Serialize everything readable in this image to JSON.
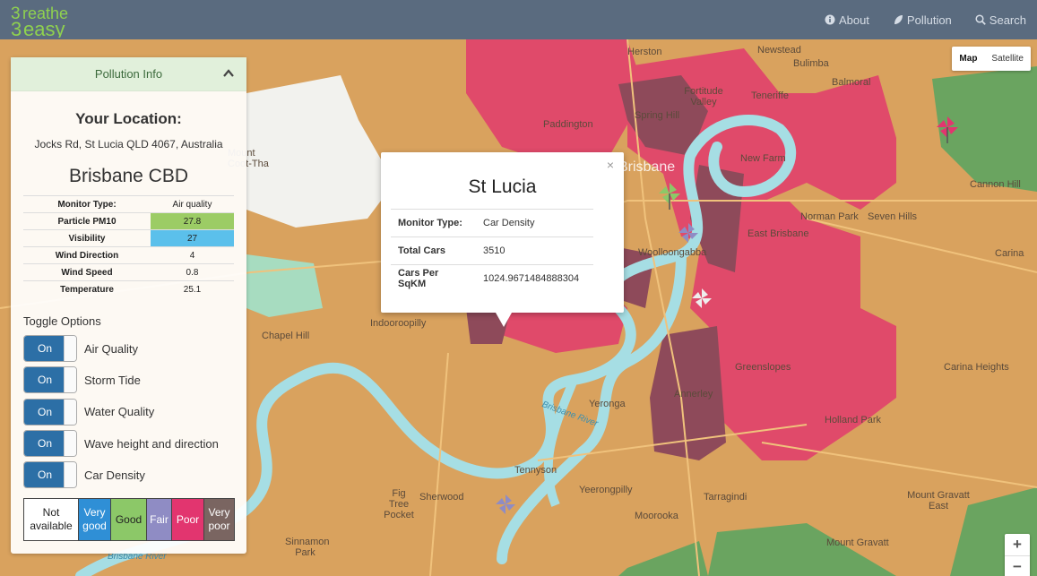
{
  "navbar": {
    "logo_text_top": "reathe",
    "logo_text_bottom": "easy",
    "links": [
      {
        "label": "About",
        "icon": "info-circle-icon"
      },
      {
        "label": "Pollution",
        "icon": "leaf-icon"
      },
      {
        "label": "Search",
        "icon": "search-icon"
      }
    ]
  },
  "map_controls": {
    "map_type": [
      "Map",
      "Satellite"
    ],
    "active_map_type": "Map",
    "zoom_in": "+",
    "zoom_out": "−"
  },
  "map_labels": {
    "brisbane": "Brisbane",
    "herston": "Herston",
    "newstead": "Newstead",
    "bulimba": "Bulimba",
    "balmoral": "Balmoral",
    "fortitude_valley": "Fortitude Valley",
    "teneriffe": "Teneriffe",
    "spring_hill": "Spring Hill",
    "paddington": "Paddington",
    "new_farm": "New Farm",
    "cannon_hill": "Cannon Hill",
    "norman_park": "Norman Park",
    "seven_hills": "Seven Hills",
    "east_brisbane": "East Brisbane",
    "woolloongabba": "Woolloongabba",
    "carina": "Carina",
    "mount_coot_tha": "Mount Coot-Tha",
    "chapel_hill": "Chapel Hill",
    "indooroopilly": "Indooroopilly",
    "greenslopes": "Greenslopes",
    "carina_heights": "Carina Heights",
    "annerley": "Annerley",
    "yeronga": "Yeronga",
    "holland_park": "Holland Park",
    "tennyson": "Tennyson",
    "yeerongpilly": "Yeerongpilly",
    "tarragindi": "Tarragindi",
    "fig_tree_pocket": "Fig Tree Pocket",
    "sherwood": "Sherwood",
    "moorooka": "Moorooka",
    "mount_gravatt_east": "Mount Gravatt East",
    "mount_gravatt": "Mount Gravatt",
    "sinnamon_park": "Sinnamon Park",
    "brisbane_river": "Brisbane River"
  },
  "panel": {
    "header": "Pollution Info",
    "your_location_label": "Your Location:",
    "address": "Jocks Rd, St Lucia QLD 4067, Australia",
    "station": "Brisbane CBD",
    "readings": [
      {
        "key": "Monitor Type:",
        "value": "Air quality",
        "color": ""
      },
      {
        "key": "Particle PM10",
        "value": "27.8",
        "color": "#9ccc65"
      },
      {
        "key": "Visibility",
        "value": "27",
        "color": "#5bc0eb"
      },
      {
        "key": "Wind Direction",
        "value": "4",
        "color": ""
      },
      {
        "key": "Wind Speed",
        "value": "0.8",
        "color": ""
      },
      {
        "key": "Temperature",
        "value": "25.1",
        "color": ""
      }
    ],
    "toggle_title": "Toggle Options",
    "toggles": [
      {
        "state": "On",
        "label": "Air Quality"
      },
      {
        "state": "On",
        "label": "Storm Tide"
      },
      {
        "state": "On",
        "label": "Water Quality"
      },
      {
        "state": "On",
        "label": "Wave height and direction"
      },
      {
        "state": "On",
        "label": "Car Density"
      }
    ],
    "legend": [
      {
        "label": "Not available",
        "bg": "#ffffff",
        "fg": "#222222"
      },
      {
        "label": "Very good",
        "bg": "#2f8fd6",
        "fg": "#ffffff"
      },
      {
        "label": "Good",
        "bg": "#8cc868",
        "fg": "#222222"
      },
      {
        "label": "Fair",
        "bg": "#8f8cc4",
        "fg": "#ffffff"
      },
      {
        "label": "Poor",
        "bg": "#e2356f",
        "fg": "#ffffff"
      },
      {
        "label": "Very poor",
        "bg": "#7a6561",
        "fg": "#ffffff"
      }
    ]
  },
  "info_window": {
    "title": "St Lucia",
    "close": "×",
    "rows": [
      {
        "key": "Monitor Type:",
        "value": "Car Density"
      },
      {
        "key": "Total Cars",
        "value": "3510"
      },
      {
        "key": "Cars Per SqKM",
        "value": "1024.9671484888304"
      }
    ]
  }
}
